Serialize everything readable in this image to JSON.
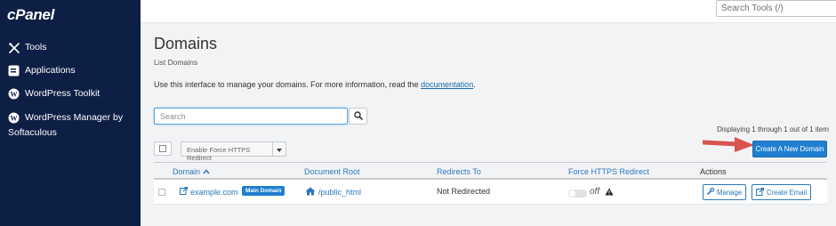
{
  "sidebar": {
    "logo": "cPanel",
    "items": [
      {
        "label": "Tools",
        "icon": "tools-icon"
      },
      {
        "label": "Applications",
        "icon": "applications-icon"
      },
      {
        "label": "WordPress Toolkit",
        "icon": "wordpress-icon"
      },
      {
        "label": "WordPress Manager by Softaculous",
        "icon": "wordpress-icon"
      }
    ]
  },
  "topbar": {
    "search_placeholder": "Search Tools (/)"
  },
  "page": {
    "title": "Domains",
    "subtitle": "List Domains",
    "intro_text": "Use this interface to manage your domains. For more information, read the ",
    "intro_link": "documentation",
    "intro_end": "."
  },
  "search": {
    "placeholder": "Search"
  },
  "toolbar": {
    "force_https_label": "Enable Force HTTPS Redirect",
    "create_label": "Create A New Domain",
    "displaying": "Displaying 1 through 1 out of 1 item"
  },
  "table": {
    "headers": {
      "domain": "Domain",
      "document_root": "Document Root",
      "redirects_to": "Redirects To",
      "force_https": "Force HTTPS Redirect",
      "actions": "Actions"
    },
    "rows": [
      {
        "domain": "example.com",
        "badge": "Main Domain",
        "document_root": "/public_html",
        "redirects_to": "Not Redirected",
        "force_https_state": "off",
        "manage_label": "Manage",
        "create_email_label": "Create Email"
      }
    ]
  },
  "colors": {
    "sidebar_bg": "#0d1f45",
    "accent": "#1f7fd0",
    "link": "#2a78bd",
    "arrow": "#d9534f"
  }
}
